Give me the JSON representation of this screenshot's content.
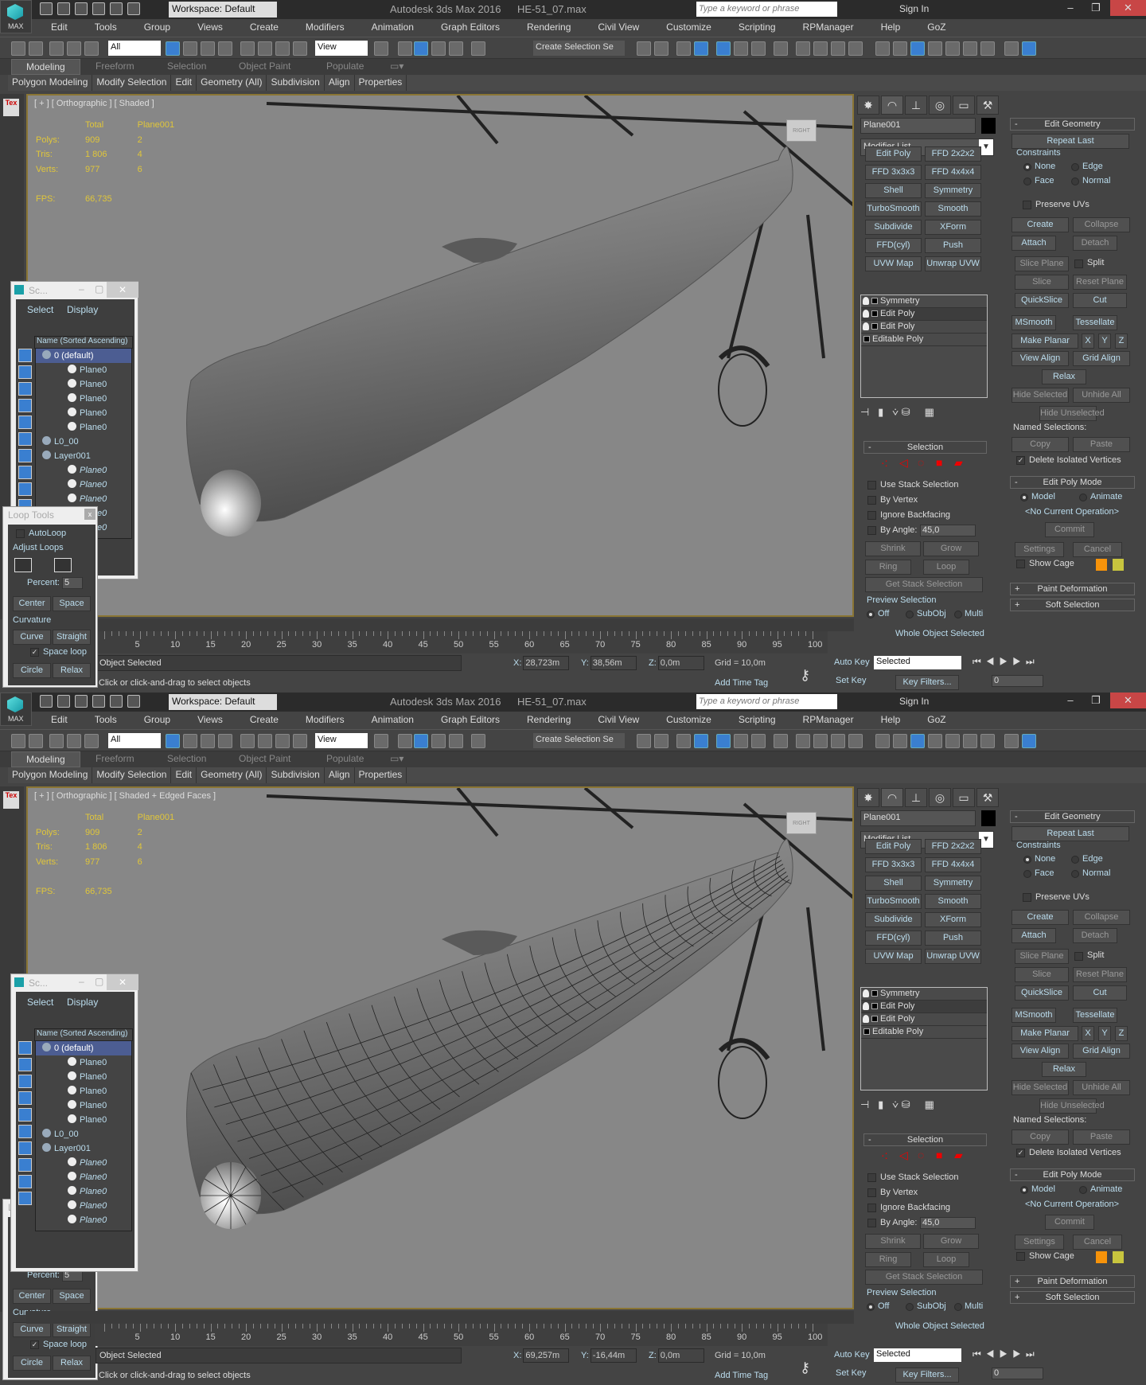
{
  "app": {
    "logo_label": "MAX",
    "workspace": "Workspace: Default",
    "title": "Autodesk 3ds Max 2016",
    "filename": "HE-51_07.max",
    "search_placeholder": "Type a keyword or phrase",
    "sign_in": "Sign In",
    "menu": [
      "Edit",
      "Tools",
      "Group",
      "Views",
      "Create",
      "Modifiers",
      "Animation",
      "Graph Editors",
      "Rendering",
      "Civil View",
      "Customize",
      "Scripting",
      "RPManager",
      "Help",
      "GoZ"
    ],
    "toolbar": {
      "filter": "All",
      "refcoord": "View",
      "selection_set": "Create Selection Se"
    },
    "ribbon_tabs": [
      "Modeling",
      "Freeform",
      "Selection",
      "Object Paint",
      "Populate"
    ],
    "ribbon_panels": [
      "Polygon Modeling",
      "Modify Selection",
      "Edit",
      "Geometry (All)",
      "Subdivision",
      "Align",
      "Properties"
    ],
    "tex_label": "Tex",
    "stats": {
      "col_total": "Total",
      "col_object": "Plane001",
      "rows": [
        {
          "label": "Polys:",
          "total": "909",
          "object": "2"
        },
        {
          "label": "Tris:",
          "total": "1 806",
          "object": "4"
        },
        {
          "label": "Verts:",
          "total": "977",
          "object": "6"
        }
      ],
      "fps_label": "FPS:",
      "fps": "66,735"
    },
    "viewcube_label": "RIGHT",
    "command_panel": {
      "object_name": "Plane001",
      "object_color": "#000000",
      "modifier_list": "Modifier List",
      "modifier_buttons": [
        "Edit Poly",
        "FFD 2x2x2",
        "FFD 3x3x3",
        "FFD 4x4x4",
        "Shell",
        "Symmetry",
        "TurboSmooth",
        "Smooth",
        "Subdivide",
        "XForm",
        "FFD(cyl)",
        "Push",
        "UVW Map",
        "Unwrap UVW"
      ],
      "stack": [
        "Symmetry",
        "Edit Poly",
        "Edit Poly",
        "Editable Poly"
      ],
      "edit_geometry": {
        "title": "Edit Geometry",
        "repeat_last": "Repeat Last",
        "constraints": "Constraints",
        "none": "None",
        "edge": "Edge",
        "face": "Face",
        "normal": "Normal",
        "preserve_uvs": "Preserve UVs",
        "create": "Create",
        "collapse": "Collapse",
        "attach": "Attach",
        "detach": "Detach",
        "slice_plane": "Slice Plane",
        "split": "Split",
        "slice": "Slice",
        "reset_plane": "Reset Plane",
        "quickslice": "QuickSlice",
        "cut": "Cut",
        "msmooth": "MSmooth",
        "tessellate": "Tessellate",
        "make_planar": "Make Planar",
        "x": "X",
        "y": "Y",
        "z": "Z",
        "view_align": "View Align",
        "grid_align": "Grid Align",
        "relax": "Relax",
        "hide_selected": "Hide Selected",
        "unhide_all": "Unhide All",
        "hide_unselected": "Hide Unselected",
        "named_selections": "Named Selections:",
        "copy": "Copy",
        "paste": "Paste",
        "delete_isolated": "Delete Isolated Vertices"
      },
      "edit_poly_mode": {
        "title": "Edit Poly Mode",
        "model": "Model",
        "animate": "Animate",
        "current_op": "<No Current Operation>",
        "commit": "Commit",
        "settings": "Settings",
        "cancel": "Cancel",
        "show_cage": "Show Cage",
        "cage_color_1": "#f7930a",
        "cage_color_2": "#c8c53e"
      },
      "paint_deformation": "Paint Deformation",
      "soft_selection": "Soft Selection",
      "selection": {
        "title": "Selection",
        "use_stack": "Use Stack Selection",
        "by_vertex": "By Vertex",
        "ignore_backfacing": "Ignore Backfacing",
        "by_angle": "By Angle:",
        "angle": "45,0",
        "shrink": "Shrink",
        "grow": "Grow",
        "ring": "Ring",
        "loop": "Loop",
        "get_stack": "Get Stack Selection",
        "preview": "Preview Selection",
        "off": "Off",
        "subobj": "SubObj",
        "multi": "Multi",
        "status": "Whole Object Selected"
      }
    },
    "scene_explorer": {
      "title": "Sc...",
      "menu_select": "Select",
      "menu_display": "Display",
      "column": "Name (Sorted Ascending)",
      "rows": [
        {
          "name": "0 (default)",
          "type": "layer"
        },
        {
          "name": "Plane0",
          "type": "obj"
        },
        {
          "name": "Plane0",
          "type": "obj"
        },
        {
          "name": "Plane0",
          "type": "obj"
        },
        {
          "name": "Plane0",
          "type": "obj"
        },
        {
          "name": "Plane0",
          "type": "obj"
        },
        {
          "name": "L0_00",
          "type": "layer"
        },
        {
          "name": "Layer001",
          "type": "layer"
        },
        {
          "name": "Plane0",
          "type": "hidden"
        },
        {
          "name": "Plane0",
          "type": "hidden"
        },
        {
          "name": "Plane0",
          "type": "hidden"
        },
        {
          "name": "Plane0",
          "type": "hidden"
        },
        {
          "name": "Plane0",
          "type": "hidden"
        }
      ]
    },
    "loop_tools": {
      "title": "Loop Tools",
      "autoloop": "AutoLoop",
      "adjust_loops": "Adjust Loops",
      "percent_label": "Percent:",
      "percent": "5",
      "center": "Center",
      "space": "Space",
      "curvature": "Curvature",
      "curve": "Curve",
      "straight": "Straight",
      "space_loop": "Space loop",
      "circle": "Circle",
      "relax": "Relax"
    },
    "timeline": {
      "ticks": [
        5,
        10,
        15,
        20,
        25,
        30,
        35,
        40,
        45,
        50,
        55,
        60,
        65,
        70,
        75,
        80,
        85,
        90,
        95,
        100
      ]
    },
    "status": {
      "selected": "Object Selected",
      "prompt": "Click or click-and-drag to select objects",
      "z": "0,0m",
      "grid": "Grid = 10,0m",
      "add_time_tag": "Add Time Tag",
      "auto_key": "Auto Key",
      "set_key": "Set Key",
      "key_mode": "Selected",
      "key_filters": "Key Filters...",
      "frame": "0"
    }
  },
  "screens": [
    {
      "viewport_label": "[ + ] [ Orthographic ] [ Shaded ]",
      "x": "28,723m",
      "y": "38,56m",
      "wireframe": false
    },
    {
      "viewport_label": "[ + ] [ Orthographic ] [ Shaded + Edged Faces ]",
      "x": "69,257m",
      "y": "-16,44m",
      "wireframe": true
    }
  ]
}
